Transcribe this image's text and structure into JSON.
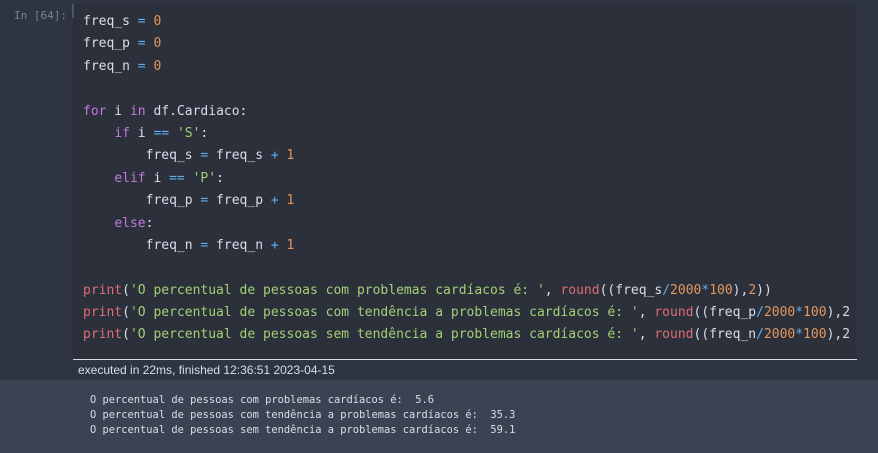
{
  "cell": {
    "prompt": "In [64]:",
    "code_lines": [
      [
        {
          "t": "freq_s ",
          "c": ""
        },
        {
          "t": "=",
          "c": "op"
        },
        {
          "t": " ",
          "c": ""
        },
        {
          "t": "0",
          "c": "num"
        }
      ],
      [
        {
          "t": "freq_p ",
          "c": ""
        },
        {
          "t": "=",
          "c": "op"
        },
        {
          "t": " ",
          "c": ""
        },
        {
          "t": "0",
          "c": "num"
        }
      ],
      [
        {
          "t": "freq_n ",
          "c": ""
        },
        {
          "t": "=",
          "c": "op"
        },
        {
          "t": " ",
          "c": ""
        },
        {
          "t": "0",
          "c": "num"
        }
      ],
      [],
      [
        {
          "t": "for",
          "c": "kw"
        },
        {
          "t": " i ",
          "c": ""
        },
        {
          "t": "in",
          "c": "kw"
        },
        {
          "t": " df.Cardiaco:",
          "c": ""
        }
      ],
      [
        {
          "t": "    ",
          "c": ""
        },
        {
          "t": "if",
          "c": "kw"
        },
        {
          "t": " i ",
          "c": ""
        },
        {
          "t": "==",
          "c": "op"
        },
        {
          "t": " ",
          "c": ""
        },
        {
          "t": "'S'",
          "c": "str"
        },
        {
          "t": ":",
          "c": ""
        }
      ],
      [
        {
          "t": "        freq_s ",
          "c": ""
        },
        {
          "t": "=",
          "c": "op"
        },
        {
          "t": " freq_s ",
          "c": ""
        },
        {
          "t": "+",
          "c": "op"
        },
        {
          "t": " ",
          "c": ""
        },
        {
          "t": "1",
          "c": "num"
        }
      ],
      [
        {
          "t": "    ",
          "c": ""
        },
        {
          "t": "elif",
          "c": "kw"
        },
        {
          "t": " i ",
          "c": ""
        },
        {
          "t": "==",
          "c": "op"
        },
        {
          "t": " ",
          "c": ""
        },
        {
          "t": "'P'",
          "c": "str"
        },
        {
          "t": ":",
          "c": ""
        }
      ],
      [
        {
          "t": "        freq_p ",
          "c": ""
        },
        {
          "t": "=",
          "c": "op"
        },
        {
          "t": " freq_p ",
          "c": ""
        },
        {
          "t": "+",
          "c": "op"
        },
        {
          "t": " ",
          "c": ""
        },
        {
          "t": "1",
          "c": "num"
        }
      ],
      [
        {
          "t": "    ",
          "c": ""
        },
        {
          "t": "else",
          "c": "kw"
        },
        {
          "t": ":",
          "c": ""
        }
      ],
      [
        {
          "t": "        freq_n ",
          "c": ""
        },
        {
          "t": "=",
          "c": "op"
        },
        {
          "t": " freq_n ",
          "c": ""
        },
        {
          "t": "+",
          "c": "op"
        },
        {
          "t": " ",
          "c": ""
        },
        {
          "t": "1",
          "c": "num"
        }
      ],
      [],
      [
        {
          "t": "print",
          "c": "fn"
        },
        {
          "t": "(",
          "c": ""
        },
        {
          "t": "'O percentual de pessoas com problemas cardíacos é: '",
          "c": "str"
        },
        {
          "t": ", ",
          "c": ""
        },
        {
          "t": "round",
          "c": "fn"
        },
        {
          "t": "((freq_s",
          "c": ""
        },
        {
          "t": "/",
          "c": "op"
        },
        {
          "t": "2000",
          "c": "num"
        },
        {
          "t": "*",
          "c": "op"
        },
        {
          "t": "100",
          "c": "num"
        },
        {
          "t": "),",
          "c": ""
        },
        {
          "t": "2",
          "c": "num"
        },
        {
          "t": "))",
          "c": ""
        }
      ],
      [
        {
          "t": "print",
          "c": "fn"
        },
        {
          "t": "(",
          "c": ""
        },
        {
          "t": "'O percentual de pessoas com tendência a problemas cardíacos é: '",
          "c": "str"
        },
        {
          "t": ", ",
          "c": ""
        },
        {
          "t": "round",
          "c": "fn"
        },
        {
          "t": "((freq_p",
          "c": ""
        },
        {
          "t": "/",
          "c": "op"
        },
        {
          "t": "2000",
          "c": "num"
        },
        {
          "t": "*",
          "c": "op"
        },
        {
          "t": "100",
          "c": "num"
        },
        {
          "t": "),2",
          "c": ""
        }
      ],
      [
        {
          "t": "print",
          "c": "fn"
        },
        {
          "t": "(",
          "c": ""
        },
        {
          "t": "'O percentual de pessoas sem tendência a problemas cardíacos é: '",
          "c": "str"
        },
        {
          "t": ", ",
          "c": ""
        },
        {
          "t": "round",
          "c": "fn"
        },
        {
          "t": "((freq_n",
          "c": ""
        },
        {
          "t": "/",
          "c": "op"
        },
        {
          "t": "2000",
          "c": "num"
        },
        {
          "t": "*",
          "c": "op"
        },
        {
          "t": "100",
          "c": "num"
        },
        {
          "t": "),2",
          "c": ""
        }
      ]
    ],
    "execution_info": "executed in 22ms, finished 12:36:51 2023-04-15",
    "output_lines": [
      "O percentual de pessoas com problemas cardíacos é:  5.6",
      "O percentual de pessoas com tendência a problemas cardíacos é:  35.3",
      "O percentual de pessoas sem tendência a problemas cardíacos é:  59.1"
    ]
  },
  "colors": {
    "background": "#2e3440",
    "editor_background": "#2b303b",
    "output_background": "#3b4252",
    "keyword": "#c678dd",
    "operator": "#61afef",
    "number": "#e5965c",
    "string": "#a3d075",
    "builtin": "#e06c75"
  }
}
